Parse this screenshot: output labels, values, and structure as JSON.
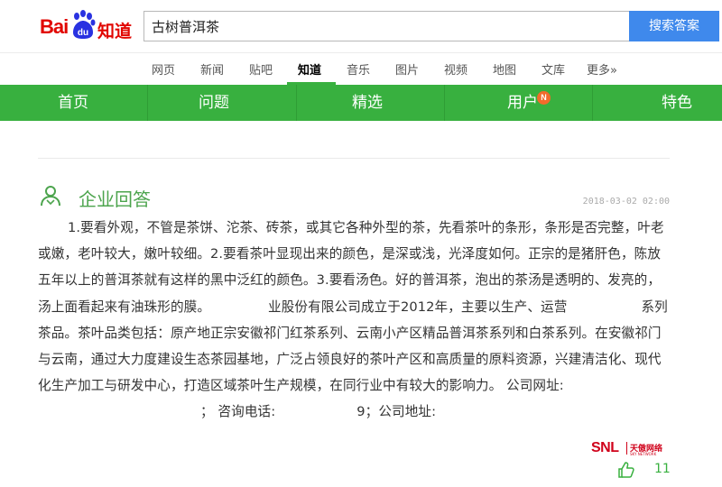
{
  "header": {
    "logo_bai": "Bai",
    "logo_du": "du",
    "logo_zhidao": "知道",
    "search_value": "古树普洱茶",
    "search_button": "搜索答案"
  },
  "subnav": [
    "网页",
    "新闻",
    "贴吧",
    "知道",
    "音乐",
    "图片",
    "视频",
    "地图",
    "文库",
    "更多»"
  ],
  "subnav_active": "知道",
  "greenbar": {
    "items": [
      "首页",
      "问题",
      "精选",
      "用户",
      "特色"
    ],
    "badge": "N"
  },
  "answer": {
    "section_title": "企业回答",
    "timestamp": "2018-03-02 02:00",
    "text_1": "1.要看外观，不管是茶饼、沱茶、砖茶，或其它各种外型的茶，先看茶叶的条形，条形是否完整，叶老或嫩，老叶较大，嫩叶较细。2.要看茶叶显现出来的颜色，是深或浅，光泽度如何。正宗的是猪肝色，陈放五年以上的普洱茶就有这样的黑中泛红的颜色。3.要看汤色。好的普洱茶，泡出的茶汤是透明的、发亮的，汤上面看起来有油珠形的膜。",
    "text_2": "业股份有限公司成立于2012年，主要以生产、运营",
    "text_3": "系列茶品。茶叶品类包括：原产地正宗安徽祁门红茶系列、云南小产区精品普洱茶系列和白茶系列。在安徽祁门与云南，通过大力度建设生态茶园基地，广泛占领良好的茶叶产区和高质量的原料资源，兴建清洁化、现代化生产加工与研发中心，打造区域茶叶生产规模，在同行业中有较大的影响力。 公司网址:",
    "text_4": "； 咨询电话:",
    "text_5": "9；公司地址:",
    "like_count": "11"
  },
  "watermark": {
    "snl": "SNL",
    "cn": "天傲网络",
    "en": "SKY NETWORK"
  },
  "colors": {
    "brand_red": "#e10601",
    "brand_blue": "#3f89ec",
    "green": "#38b03f",
    "section_green": "#4ca44d"
  }
}
